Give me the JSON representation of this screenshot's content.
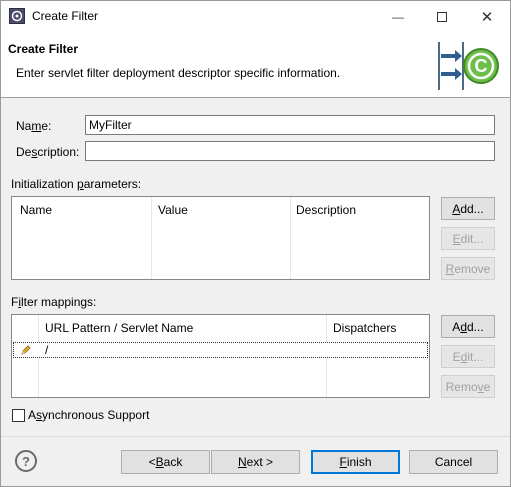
{
  "window": {
    "title": "Create Filter",
    "controls": {
      "minimize": "—",
      "maximize": "☐",
      "close": "✕"
    }
  },
  "banner": {
    "title": "Create Filter",
    "description": "Enter servlet filter deployment descriptor specific information."
  },
  "form": {
    "name_label_pre": "Na",
    "name_label_u": "m",
    "name_label_post": "e:",
    "name_value": "MyFilter",
    "description_label_pre": "De",
    "description_label_u": "s",
    "description_label_post": "cription:",
    "description_value": ""
  },
  "init_params": {
    "label_pre": "Initialization ",
    "label_u": "p",
    "label_post": "arameters:",
    "columns": [
      "Name",
      "Value",
      "Description"
    ],
    "add_pre": "",
    "add_u": "A",
    "add_post": "dd...",
    "edit_pre": "",
    "edit_u": "E",
    "edit_post": "dit...",
    "remove_pre": "",
    "remove_u": "R",
    "remove_post": "emove"
  },
  "filter_mappings": {
    "label_pre": "F",
    "label_u": "i",
    "label_post": "lter mappings:",
    "columns": [
      "URL Pattern / Servlet Name",
      "Dispatchers"
    ],
    "rows": [
      {
        "pattern": "/",
        "dispatchers": "",
        "icon": "pencil-icon"
      }
    ],
    "add_pre": "A",
    "add_u": "d",
    "add_post": "d...",
    "edit_pre": "E",
    "edit_u": "d",
    "edit_post": "it...",
    "remove_pre": "Remo",
    "remove_u": "v",
    "remove_post": "e"
  },
  "async": {
    "label_pre": "A",
    "label_u": "s",
    "label_post": "ynchronous Support",
    "checked": false
  },
  "footer": {
    "help": "?",
    "back_pre": "< ",
    "back_u": "B",
    "back_post": "ack",
    "next_pre": "",
    "next_u": "N",
    "next_post": "ext >",
    "finish_pre": "",
    "finish_u": "F",
    "finish_post": "inish",
    "cancel": "Cancel"
  }
}
